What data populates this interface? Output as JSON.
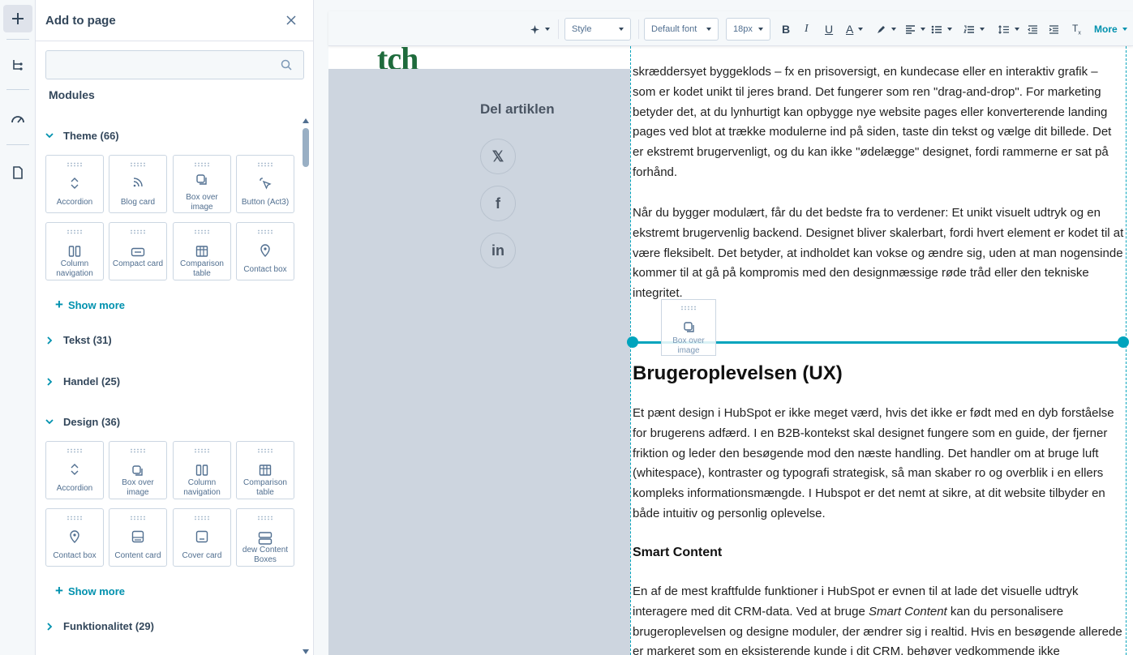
{
  "colors": {
    "accent": "#0091ae",
    "drop_indicator": "#00a4bd",
    "text": "#33475b",
    "sidebar_bg": "#cdd5df",
    "logo": "#1e6b3c"
  },
  "rail": {
    "items": [
      {
        "icon": "plus-icon",
        "active": true
      },
      {
        "icon": "layers-tree-icon"
      },
      {
        "icon": "gauge-icon"
      },
      {
        "icon": "page-icon"
      }
    ]
  },
  "panel": {
    "title": "Add to page",
    "search": {
      "value": "",
      "placeholder": ""
    },
    "modules_label": "Modules",
    "categories": [
      {
        "label": "Theme (66)",
        "expanded": true,
        "modules": [
          "Accordion",
          "Blog card",
          "Box over image",
          "Button (Act3)",
          "Column navigation",
          "Compact card",
          "Comparison table",
          "Contact box"
        ],
        "show_more": "Show more"
      },
      {
        "label": "Tekst (31)",
        "expanded": false
      },
      {
        "label": "Handel (25)",
        "expanded": false
      },
      {
        "label": "Design (36)",
        "expanded": true,
        "modules": [
          "Accordion",
          "Box over image",
          "Column navigation",
          "Comparison table",
          "Contact box",
          "Content card",
          "Cover card",
          "dew Content Boxes"
        ],
        "show_more": "Show more"
      },
      {
        "label": "Funktionalitet (29)",
        "expanded": false
      }
    ]
  },
  "toolbar": {
    "style": "Style",
    "font": "Default font",
    "size": "18px",
    "more": "More"
  },
  "page": {
    "logo_fragment": "tch",
    "share_title": "Del artiklen",
    "social": [
      "𝕏",
      "f",
      "in"
    ],
    "paragraphs": [
      "skræddersyet byggeklods – fx en prisoversigt, en kundecase eller en interaktiv grafik – som er kodet unikt til jeres brand. Det fungerer som ren \"drag-and-drop\". For marketing betyder det, at du lynhurtigt kan opbygge nye website pages eller konverterende landing pages ved blot at trække modulerne ind på siden, taste din tekst og vælge dit billede. Det er ekstremt brugervenligt, og du kan ikke \"ødelægge\" designet, fordi rammerne er sat på forhånd.",
      "Når du bygger modulært, får du det bedste fra to verdener: Et unikt visuelt udtryk og en ekstremt brugervenlig backend. Designet bliver skalerbart, fordi hvert element er kodet til at være fleksibelt. Det betyder, at indholdet kan vokse og ændre sig, uden at man nogensinde kommer til at gå på kompromis med den designmæssige røde tråd eller den tekniske integritet.",
      "Et pænt design i HubSpot er ikke meget værd, hvis det ikke er født med en dyb forståelse for brugerens adfærd. I en B2B-kontekst skal designet fungere som en guide, der fjerner friktion og leder den besøgende mod den næste handling. Det handler om at bruge luft (whitespace), kontraster og typografi strategisk, så man skaber ro og overblik i en ellers kompleks informationsmængde. I Hubspot er det nemt at sikre, at dit website tilbyder en både intuitiv og personlig oplevelse."
    ],
    "heading_ux": "Brugeroplevelsen (UX)",
    "heading_smart": "Smart Content",
    "smart_before": "En af de mest kraftfulde funktioner i HubSpot er evnen til at lade det visuelle udtryk interagere med dit CRM-data. Ved at bruge ",
    "smart_em": "Smart Content",
    "smart_after": " kan du personalisere brugeroplevelsen og designe moduler, der ændrer sig i realtid. Hvis en besøgende allerede er markeret som en eksisterende kunde i dit CRM, behøver vedkommende ikke",
    "drag_ghost_label": "Box over image"
  }
}
